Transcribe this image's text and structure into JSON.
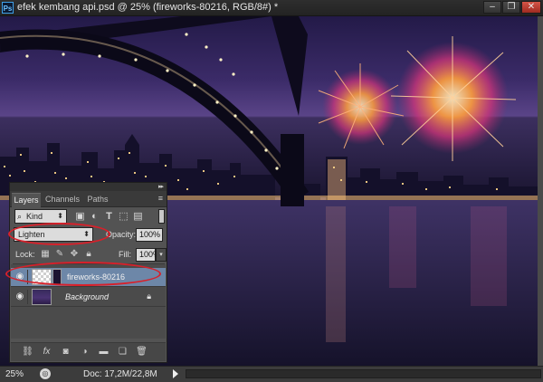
{
  "window": {
    "title": "efek kembang api.psd @ 25% (fireworks-80216, RGB/8#) *",
    "app_icon": "Ps",
    "buttons": [
      {
        "name": "minimize",
        "glyph": "–"
      },
      {
        "name": "restore",
        "glyph": "❐"
      },
      {
        "name": "close",
        "glyph": "✕"
      }
    ]
  },
  "layers_panel": {
    "tabs": [
      "Layers",
      "Channels",
      "Paths"
    ],
    "active_tab": "Layers",
    "filter": {
      "kind": "Kind",
      "icons": [
        "image-filter-icon",
        "adjustment-filter-icon",
        "type-filter-icon",
        "shape-filter-icon",
        "smart-object-filter-icon"
      ]
    },
    "blend_mode": "Lighten",
    "opacity_label": "Opacity:",
    "opacity_value": "100%",
    "lock_label": "Lock:",
    "fill_label": "Fill:",
    "fill_value": "100%",
    "layers": [
      {
        "name": "fireworks-80216",
        "visible": true,
        "selected": true
      },
      {
        "name": "Background",
        "visible": true,
        "selected": false,
        "locked": true
      }
    ],
    "footer_icons": [
      "link-icon",
      "fx-icon",
      "mask-icon",
      "adjustment-icon",
      "group-folder-icon",
      "new-layer-icon",
      "trash-icon"
    ]
  },
  "status_bar": {
    "zoom": "25%",
    "doc_size": "Doc: 17,2M/22,8M"
  },
  "colors": {
    "annotation": "#d8202a",
    "selected_layer": "#6d87a8",
    "sky_top": "#2c1f55",
    "sky_horizon": "#6a5092"
  }
}
